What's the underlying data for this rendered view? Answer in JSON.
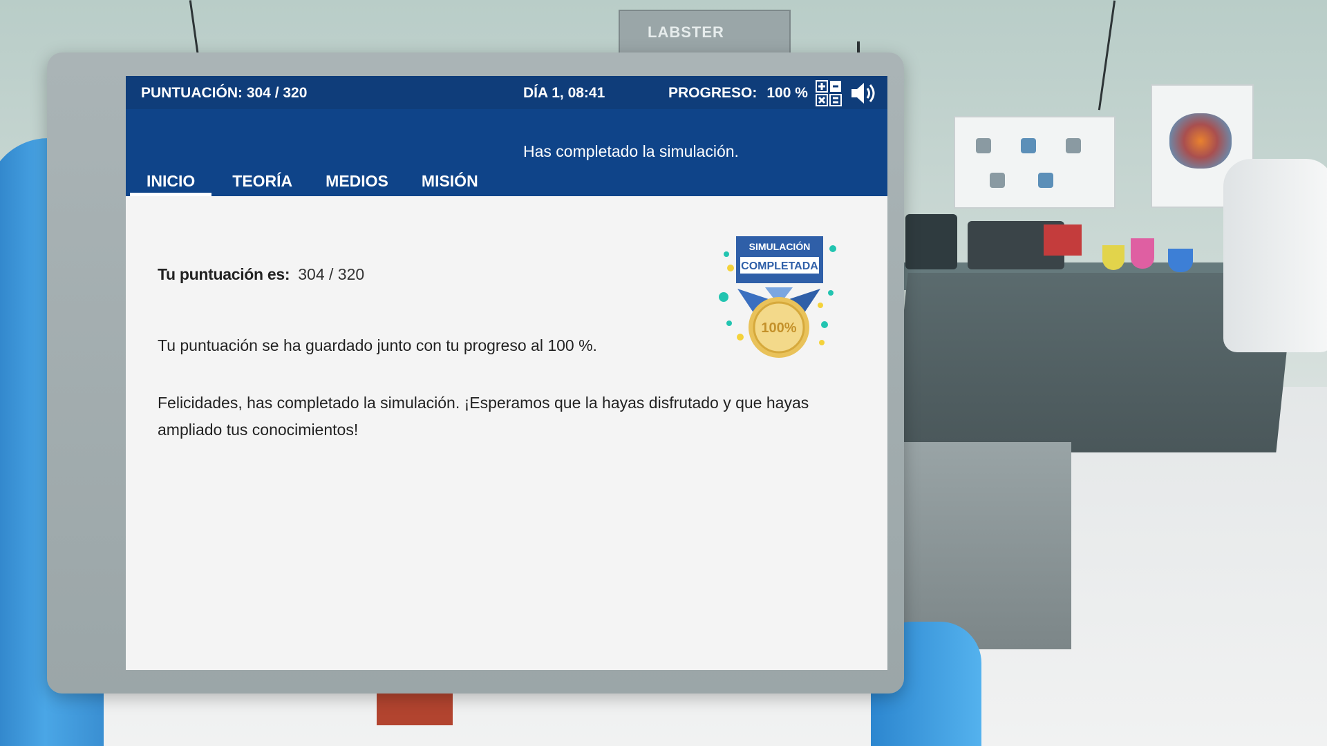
{
  "background": {
    "sign_text": "LABSTER"
  },
  "topbar": {
    "score": "PUNTUACIÓN: 304 / 320",
    "day": "DÍA 1, 08:41",
    "progress_label": "PROGRESO:",
    "progress_value": "100 %",
    "progress_fraction": 1.0,
    "calculator_icon": "calculator-icon",
    "sound_icon": "speaker-icon"
  },
  "header": {
    "message": "Has completado la simulación."
  },
  "tabs": [
    {
      "label": "INICIO",
      "active": true
    },
    {
      "label": "TEORÍA",
      "active": false
    },
    {
      "label": "MEDIOS",
      "active": false
    },
    {
      "label": "MISIÓN",
      "active": false
    }
  ],
  "content": {
    "score_label": "Tu puntuación es:",
    "score_value": "304 / 320",
    "saved_text": "Tu puntuación se ha guardado junto con tu progreso al 100 %.",
    "congrats_text": "Felicidades, has completado la simulación. ¡Esperamos que la hayas disfrutado y que hayas ampliado tus conocimientos!"
  },
  "badge": {
    "line1": "SIMULACIÓN",
    "line2": "COMPLETADA",
    "medal": "100%"
  },
  "colors": {
    "topbar": "#0f3d7a",
    "header": "#0f4489",
    "badge_blue": "#3a6fc0",
    "medal_gold": "#e9c25a",
    "confetti_teal": "#22c4b0",
    "confetti_yellow": "#f4d23a"
  }
}
